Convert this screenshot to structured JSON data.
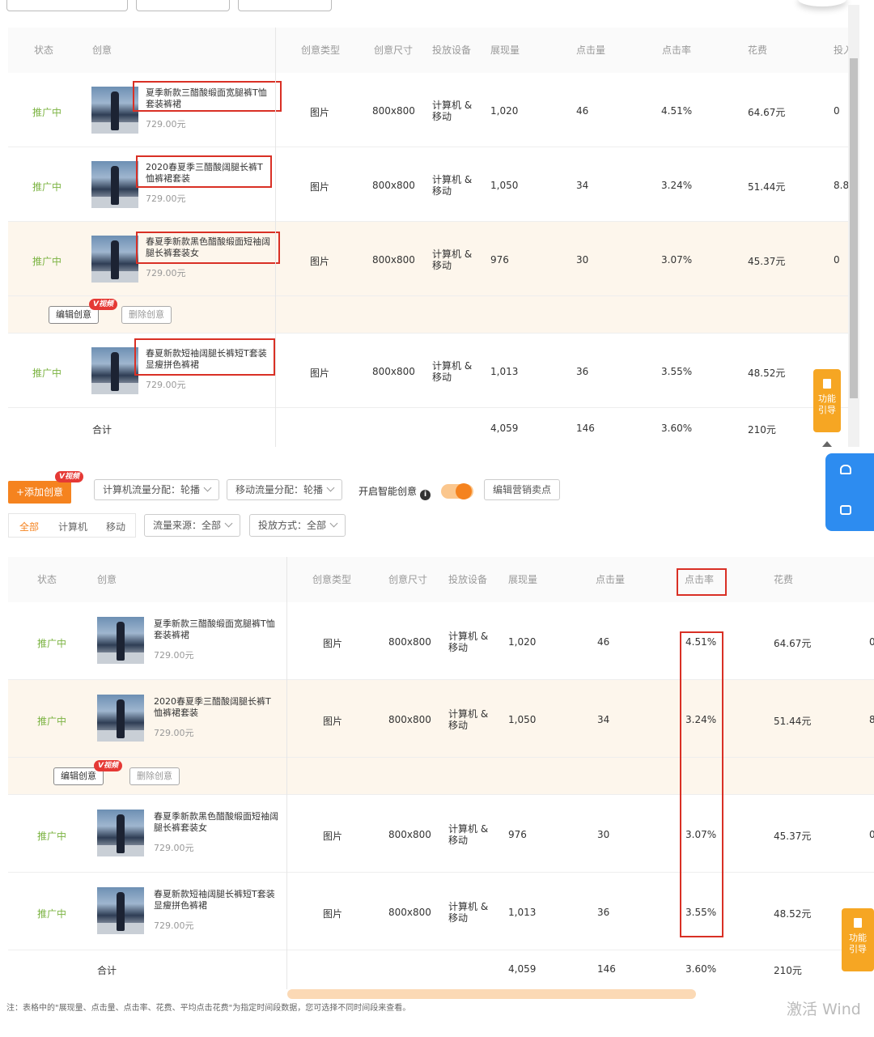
{
  "columns": {
    "status": "状态",
    "creative": "创意",
    "type": "创意类型",
    "size": "创意尺寸",
    "device": "投放设备",
    "impressions": "展现量",
    "clicks": "点击量",
    "ctr": "点击率",
    "cost": "花费",
    "roi_partial": "投入"
  },
  "rows": [
    {
      "status": "推广中",
      "title": "夏季新款三醋酸缎面宽腿裤T恤套装裤裙",
      "price": "729.00元",
      "type": "图片",
      "size": "800x800",
      "device": "计算机 & 移动",
      "impressions": "1,020",
      "clicks": "46",
      "ctr": "4.51%",
      "cost": "64.67元",
      "extra": "0"
    },
    {
      "status": "推广中",
      "title": "2020春夏季三醋酸阔腿长裤T恤裤裙套装",
      "price": "729.00元",
      "type": "图片",
      "size": "800x800",
      "device": "计算机 & 移动",
      "impressions": "1,050",
      "clicks": "34",
      "ctr": "3.24%",
      "cost": "51.44元",
      "extra": "8.8"
    },
    {
      "status": "推广中",
      "title": "春夏季新款黑色醋酸缎面短袖阔腿长裤套装女",
      "price": "729.00元",
      "type": "图片",
      "size": "800x800",
      "device": "计算机 & 移动",
      "impressions": "976",
      "clicks": "30",
      "ctr": "3.07%",
      "cost": "45.37元",
      "extra": "0"
    },
    {
      "status": "推广中",
      "title": "春夏新款短袖阔腿长裤短T套装显瘦拼色裤裙",
      "price": "729.00元",
      "type": "图片",
      "size": "800x800",
      "device": "计算机 & 移动",
      "impressions": "1,013",
      "clicks": "36",
      "ctr": "3.55%",
      "cost": "48.52元",
      "extra": ""
    }
  ],
  "total": {
    "label": "合计",
    "impressions": "4,059",
    "clicks": "146",
    "ctr": "3.60%",
    "cost": "210元"
  },
  "actions": {
    "edit": "编辑创意",
    "delete": "删除创意",
    "vbadge": "V视频"
  },
  "toolbar": {
    "add": "+添加创意",
    "pc_flow": "计算机流量分配：轮播",
    "mobile_flow": "移动流量分配：轮播",
    "smart": "开启智能创意",
    "edit_selling": "编辑营销卖点",
    "tab_all": "全部",
    "tab_pc": "计算机",
    "tab_mobile": "移动",
    "source": "流量来源：全部",
    "delivery": "投放方式：全部"
  },
  "guide": {
    "line1": "功能",
    "line2": "引导"
  },
  "note": "注：表格中的\"展现量、点击量、点击率、花费、平均点击花费\"为指定时间段数据，您可选择不同时间段来查看。",
  "watermark": "激活 Wind",
  "colors": {
    "accent": "#f5831f",
    "status": "#7cb342",
    "highlight": "#d93025",
    "panel": "#2d8cf0"
  }
}
